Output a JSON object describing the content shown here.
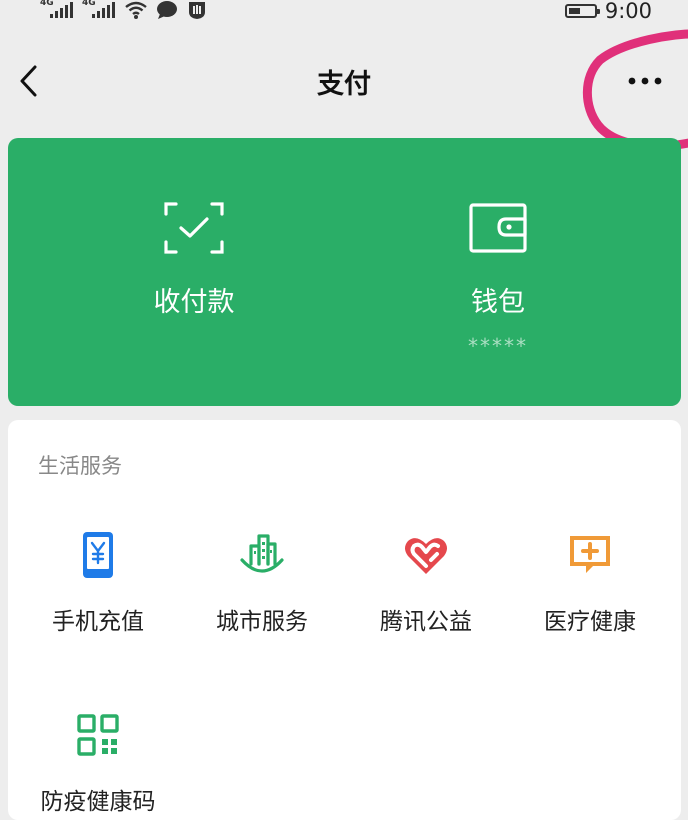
{
  "status_bar": {
    "network_1": "4G",
    "network_2": "4G",
    "battery_level": 0.45,
    "time": "9:00"
  },
  "header": {
    "title": "支付"
  },
  "payment": {
    "items": [
      {
        "label": "收付款",
        "icon": "scan-check-icon"
      },
      {
        "label": "钱包",
        "icon": "wallet-icon",
        "sub": "*****"
      }
    ]
  },
  "services": {
    "title": "生活服务",
    "items": [
      {
        "label": "手机充值",
        "icon": "phone-recharge-icon",
        "color": "#1f7be8"
      },
      {
        "label": "城市服务",
        "icon": "city-buildings-icon",
        "color": "#2aae67"
      },
      {
        "label": "腾讯公益",
        "icon": "heart-charity-icon",
        "color": "#e5484d"
      },
      {
        "label": "医疗健康",
        "icon": "medical-cross-icon",
        "color": "#f09a37"
      },
      {
        "label": "防疫健康码",
        "icon": "qr-code-icon",
        "color": "#2aae67"
      }
    ]
  },
  "colors": {
    "accent": "#2aae67",
    "annotation": "#e0307a"
  }
}
